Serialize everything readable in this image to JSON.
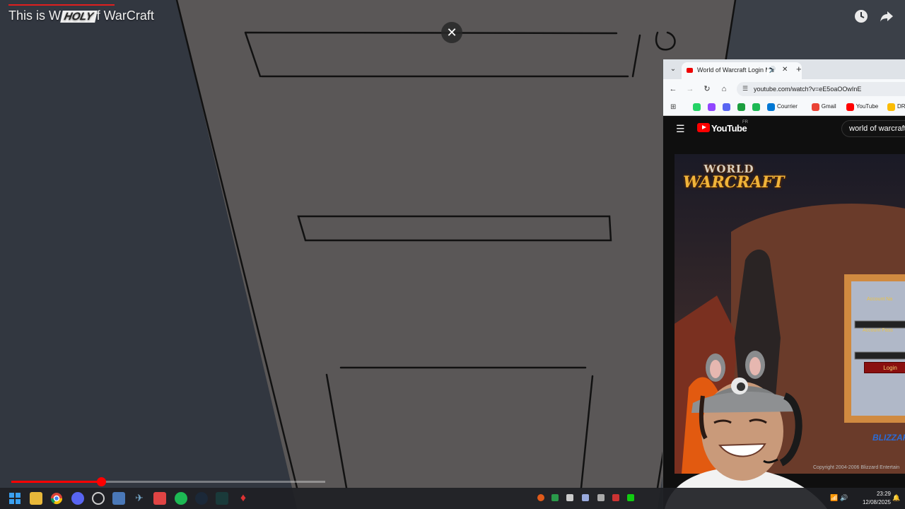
{
  "video": {
    "title_prefix": "This is W",
    "title_highlight": "HOLY",
    "title_suffix": "f WarCraft",
    "progress": 0.287
  },
  "icons": {
    "watch_later": "clock-icon",
    "share": "share-arrow-icon",
    "close": "close-icon"
  },
  "browser": {
    "tab_title": "World of Warcraft Login Mu",
    "url": "youtube.com/watch?v=eE5oaOOwInE",
    "bookmarks": [
      {
        "label": "",
        "color": "#25d366"
      },
      {
        "label": "",
        "color": "#9146ff"
      },
      {
        "label": "",
        "color": "#5865f2"
      },
      {
        "label": "",
        "color": "#1b9e3e"
      },
      {
        "label": "",
        "color": "#1db954"
      },
      {
        "label": "Courrier",
        "color": "#0078d4"
      },
      {
        "label": "Gmail",
        "color": "#ea4335"
      },
      {
        "label": "YouTube",
        "color": "#ff0000"
      },
      {
        "label": "DRIVE",
        "color": "#fbbc04"
      }
    ]
  },
  "youtube": {
    "logo_text": "YouTube",
    "region": "FR",
    "search_value": "world of warcraft"
  },
  "wow": {
    "logo_line1": "WORLD",
    "logo_line2": "WARCRAFT",
    "account_name": "Account Na",
    "account_password": "Account Pass",
    "login": "Login",
    "blizzard": "BLIZZARD",
    "copyright": "Copyright 2004-2006 Blizzard Entertain"
  },
  "taskbar": {
    "time": "23:29",
    "date": "12/08/2025"
  }
}
